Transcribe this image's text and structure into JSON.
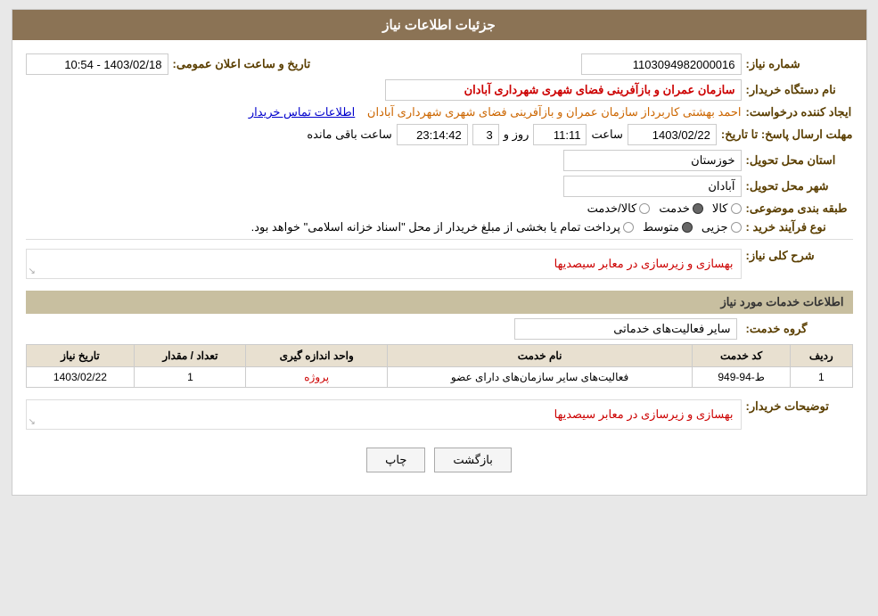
{
  "header": {
    "title": "جزئیات اطلاعات نیاز"
  },
  "fields": {
    "need_number_label": "شماره نیاز:",
    "need_number_value": "1103094982000016",
    "buyer_org_label": "نام دستگاه خریدار:",
    "buyer_org_value": "سازمان عمران و بازآفرینی فضای شهری شهرداری آبادان",
    "announcement_label": "تاریخ و ساعت اعلان عمومی:",
    "announcement_value": "1403/02/18 - 10:54",
    "creator_label": "ایجاد کننده درخواست:",
    "creator_value": "احمد بهشتی کاربرداز سازمان عمران و بازآفرینی فضای شهری شهرداری آبادان",
    "contact_info_link": "اطلاعات تماس خریدار",
    "deadline_label": "مهلت ارسال پاسخ: تا تاریخ:",
    "deadline_date": "1403/02/22",
    "deadline_time_label": "ساعت",
    "deadline_time": "11:11",
    "deadline_days_label": "روز و",
    "deadline_days": "3",
    "deadline_remaining": "23:14:42",
    "deadline_remaining_label": "ساعت باقی مانده",
    "province_label": "استان محل تحویل:",
    "province_value": "خوزستان",
    "city_label": "شهر محل تحویل:",
    "city_value": "آبادان",
    "category_label": "طبقه بندی موضوعی:",
    "category_option1": "کالا",
    "category_option2": "خدمت",
    "category_option3": "کالا/خدمت",
    "category_selected": "خدمت",
    "process_label": "نوع فرآیند خرید :",
    "process_option1": "جزیی",
    "process_option2": "متوسط",
    "process_option3": "پرداخت تمام یا بخشی از مبلغ خریدار از محل \"اسناد خزانه اسلامی\" خواهد بود.",
    "process_selected": "متوسط",
    "description_label": "شرح کلی نیاز:",
    "description_value": "بهسازی و زیرسازی در معابر سیصدیها",
    "services_header": "اطلاعات خدمات مورد نیاز",
    "service_group_label": "گروه خدمت:",
    "service_group_value": "سایر فعالیت‌های خدماتی",
    "table_headers": [
      "ردیف",
      "کد خدمت",
      "نام خدمت",
      "واحد اندازه گیری",
      "تعداد / مقدار",
      "تاریخ نیاز"
    ],
    "table_rows": [
      {
        "row": "1",
        "code": "ط-94-949",
        "name": "فعالیت‌های سایر سازمان‌های دارای عضو",
        "unit": "پروژه",
        "quantity": "1",
        "date": "1403/02/22"
      }
    ],
    "buyer_notes_label": "توضیحات خریدار:",
    "buyer_notes_value": "بهسازی و زیرسازی در معابر سیصدیها"
  },
  "buttons": {
    "back": "بازگشت",
    "print": "چاپ"
  }
}
